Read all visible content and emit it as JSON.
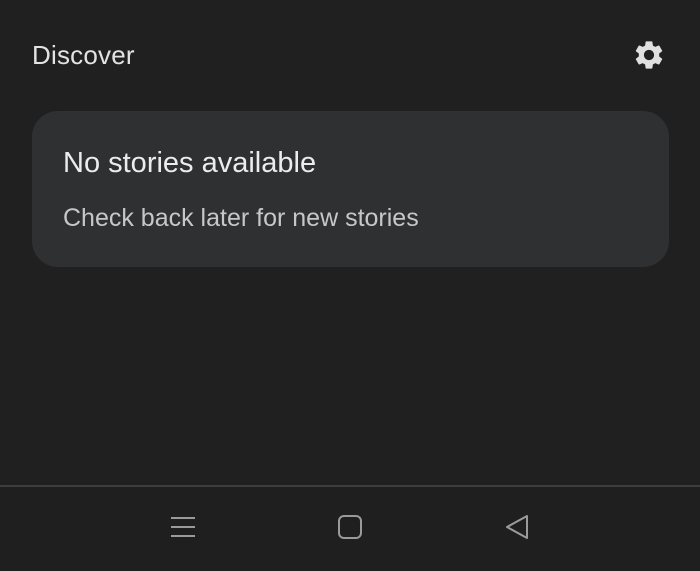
{
  "header": {
    "title": "Discover",
    "settings_icon": "gear-icon"
  },
  "card": {
    "title": "No stories available",
    "subtitle": "Check back later for new stories"
  },
  "navigation_bar": {
    "recents_icon": "menu-lines-icon",
    "home_icon": "rounded-square-home-icon",
    "back_icon": "triangle-back-icon"
  },
  "colors": {
    "background": "#202020",
    "card": "#2f3032",
    "text_primary": "#ececec",
    "text_secondary": "#c7c7c7",
    "icon": "#e0e0e0",
    "nav_icon": "#9a9a9a"
  }
}
